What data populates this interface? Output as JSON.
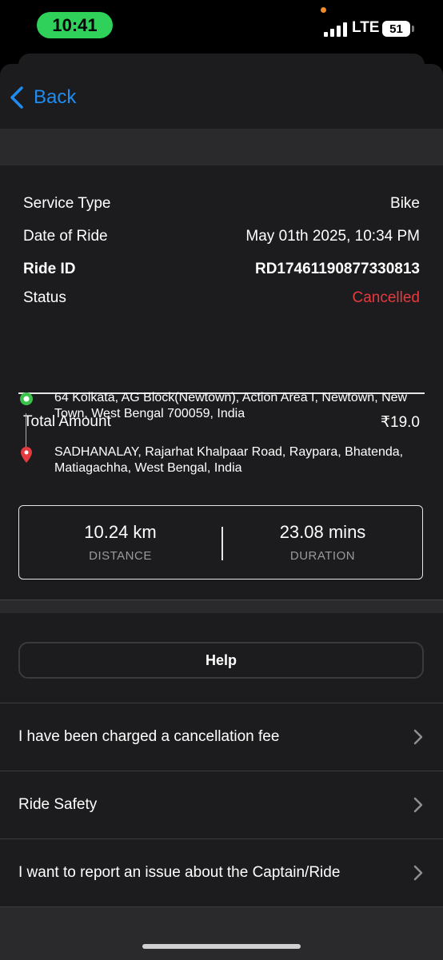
{
  "status_bar": {
    "time": "10:41",
    "network": "LTE",
    "battery": "51"
  },
  "nav": {
    "back_label": "Back"
  },
  "details": {
    "service_type_label": "Service Type",
    "service_type_value": "Bike",
    "date_label": "Date of Ride",
    "date_value": "May 01th 2025, 10:34 PM",
    "ride_id_label": "Ride ID",
    "ride_id_value": "RD17461190877330813",
    "status_label": "Status",
    "status_value": "Cancelled",
    "total_label": "Total Amount",
    "total_value": "₹19.0"
  },
  "route": {
    "pickup": "64 Kolkata, AG Block(Newtown), Action Area I, Newtown, New Town, West Bengal 700059, India",
    "drop": "SADHANALAY, Rajarhat Khalpaar Road, Raypara, Bhatenda, Matiagachha, West Bengal, India"
  },
  "stats": {
    "distance_value": "10.24 km",
    "distance_label": "DISTANCE",
    "duration_value": "23.08 mins",
    "duration_label": "DURATION"
  },
  "help": {
    "label": "Help"
  },
  "menu": [
    {
      "label": "I have been charged a cancellation fee"
    },
    {
      "label": "Ride Safety"
    },
    {
      "label": "I want to report an issue about the Captain/Ride"
    }
  ],
  "colors": {
    "accent": "#1e8cf0",
    "cancelled": "#e53a3f",
    "pickup": "#3cc24a",
    "drop": "#e53a3f"
  }
}
